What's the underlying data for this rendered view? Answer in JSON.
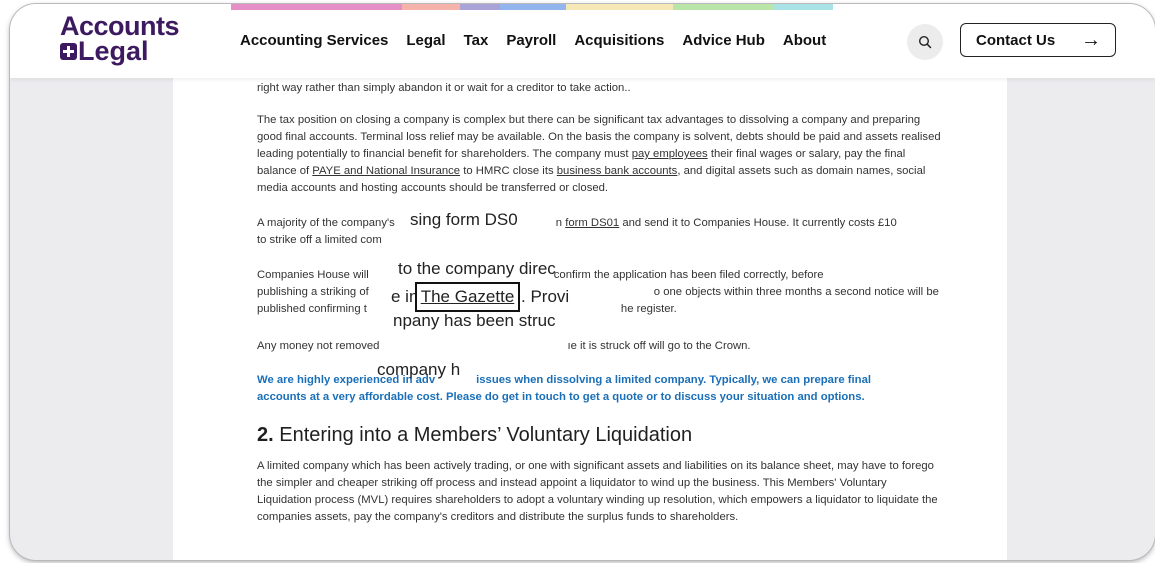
{
  "colors": {
    "brand": "#3d1a5f",
    "link_blue": "#1a6fb8",
    "color_bar": [
      "#e68fc6",
      "#f5b3a9",
      "#a9a3d8",
      "#93b5ee",
      "#f6e7b6",
      "#b9e5a8",
      "#a9e3e6"
    ]
  },
  "logo": {
    "line1": "Accounts",
    "line2": "Legal"
  },
  "nav": {
    "items": [
      "Accounting Services",
      "Legal",
      "Tax",
      "Payroll",
      "Acquisitions",
      "Advice Hub",
      "About"
    ]
  },
  "header": {
    "search_icon": "search-icon",
    "contact_label": "Contact Us",
    "contact_arrow": "→"
  },
  "article": {
    "p0": "right way rather than simply abandon it or wait for a creditor to take action..",
    "p1": {
      "t1": "The tax position on closing a company is complex but there can be significant tax advantages to dissolving a company and preparing good final accounts. Terminal loss relief may be available. On the basis the company is solvent, debts should be paid and assets realised leading potentially to financial benefit for shareholders. The company must ",
      "link1": "pay employees",
      "t2": " their final wages or salary, pay the final balance of ",
      "link2": "PAYE and National Insurance",
      "t3": " to HMRC  close its ",
      "link3": "business bank accounts",
      "t4": ", and digital assets such as domain names, social media accounts and hosting accounts should be transferred or closed."
    },
    "p2": {
      "t1": "A majority of the company's",
      "t2": "n ",
      "link": "form DS01",
      "t3": " and send it to Companies House. It currently costs £10",
      "t4": "to strike off a limited com"
    },
    "p3": {
      "l1a": "Companies House will",
      "l1b": "confirm the application has been filed correctly, before",
      "l2a": "publishing a striking of",
      "l2b": "o one objects within three months a second notice will be",
      "l3a": "published confirming t",
      "l3b": "he register."
    },
    "p4": {
      "a": "Any money not removed",
      "b": "ıe it is struck off will go to the Crown."
    },
    "p5": {
      "l1a": "We are highly experienced in adv",
      "l1b": "issues when dissolving a limited company. Typically, we can prepare final",
      "l2": "accounts at a very affordable cost. Please do get in touch to get a quote or to discuss your situation and options."
    },
    "h2": {
      "num": "2.",
      "text": " Entering into a Members’ Voluntary Liquidation"
    },
    "p6": "A limited company which has been actively trading, or one with significant assets and liabilities on its balance sheet, may have to forego the simpler and cheaper striking off process and instead appoint a liquidator to wind up the business. This Members' Voluntary Liquidation process (MVL) requires shareholders to adopt a voluntary winding up resolution, which empowers a liquidator to liquidate the companies assets, pay the company's creditors and distribute the surplus funds to shareholders."
  },
  "zoom_overlay": {
    "g1": "sing form DS0",
    "g2": "to the company direc",
    "g3a": "e in",
    "gazette": "The Gazette",
    "g3b": ". Provi",
    "g4": "npany has been struc",
    "g5": "company h"
  }
}
